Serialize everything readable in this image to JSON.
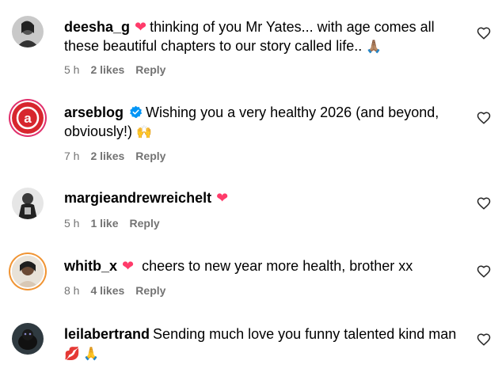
{
  "comments": [
    {
      "username": "deesha_g",
      "badge": "❤",
      "text": "thinking of you Mr Yates... with age comes all these beautiful chapters to our story called life..",
      "emoji": "🙏🏽",
      "time": "5 h",
      "likes": "2 likes",
      "reply": "Reply"
    },
    {
      "username": "arseblog",
      "text": "Wishing you a very healthy 2026 (and beyond, obviously!)",
      "emoji": "🙌",
      "time": "7 h",
      "likes": "2 likes",
      "reply": "Reply"
    },
    {
      "username": "margieandrewreichelt",
      "badge": "❤",
      "time": "5 h",
      "likes": "1 like",
      "reply": "Reply"
    },
    {
      "username": "whitb_x",
      "badge": "❤",
      "text": "cheers to new year more health, brother xx",
      "time": "8 h",
      "likes": "4 likes",
      "reply": "Reply"
    },
    {
      "username": "leilabertrand",
      "text": "Sending much love you funny talented kind man",
      "emoji": "💋 🙏",
      "time": "",
      "likes": "",
      "reply": ""
    }
  ],
  "colors": {
    "heart": "#ff3b6a",
    "meta": "#737373",
    "verified": "#0095f6",
    "arseblog_red": "#d7262e"
  },
  "icons": {
    "like": "heart-outline-icon",
    "verified": "verified-badge-icon"
  }
}
